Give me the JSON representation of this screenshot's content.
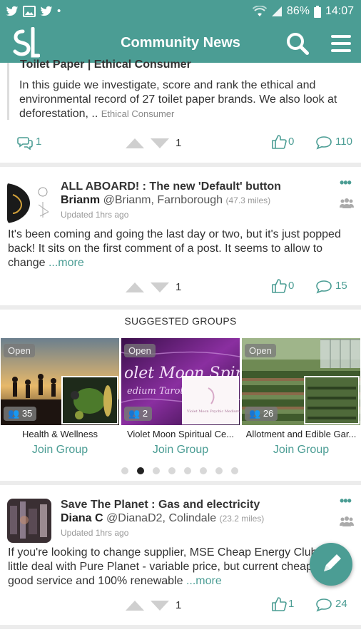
{
  "status_bar": {
    "battery": "86%",
    "time": "14:07"
  },
  "app_bar": {
    "title": "Community News"
  },
  "article_partial": {
    "title": "Toilet Paper | Ethical Consumer",
    "body": "In this guide we investigate, score and rank the ethical and environmental record of 27 toilet paper brands. We also look at deforestation, .. ",
    "source": "Ethical Consumer",
    "comments": "1",
    "votes": "1",
    "likes": "0",
    "replies": "110"
  },
  "post1": {
    "title": "ALL ABOARD! : The new 'Default' button",
    "author": "Brianm",
    "handle": "@Brianm,",
    "place": "Farnborough",
    "distance": "(47.3 miles)",
    "updated": "Updated 1hrs ago",
    "body": "It's been coming and going the last day or two, but it's just popped back! It sits on the first comment of a post. It seems to allow to change ",
    "more": "...more",
    "votes": "1",
    "likes": "0",
    "replies": "15"
  },
  "suggested_groups": {
    "heading": "SUGGESTED GROUPS",
    "groups": [
      {
        "status": "Open",
        "members": "35",
        "name": "Health & Wellness",
        "join": "Join Group"
      },
      {
        "status": "Open",
        "members": "2",
        "name": "Violet Moon Spiritual Ce...",
        "join": "Join Group"
      },
      {
        "status": "Open",
        "members": "26",
        "name": "Allotment and Edible Gar...",
        "join": "Join Group"
      }
    ],
    "pager": {
      "count": 8,
      "active_index": 1
    }
  },
  "post2": {
    "title": "Save The Planet : Gas and electricity",
    "author": "Diana C",
    "handle": "@DianaD2,",
    "place": "Colindale",
    "distance": "(23.2 miles)",
    "updated": "Updated 1hrs ago",
    "body": "If you're looking to change supplier, MSE Cheap Energy Club got a little deal with Pure Planet - variable price, but current cheapest with good service and 100% renewable ",
    "more": "...more",
    "votes": "1",
    "likes": "1",
    "replies": "24"
  },
  "colors": {
    "brand": "#4b9d94",
    "divider": "#ececec",
    "muted": "#999999"
  }
}
